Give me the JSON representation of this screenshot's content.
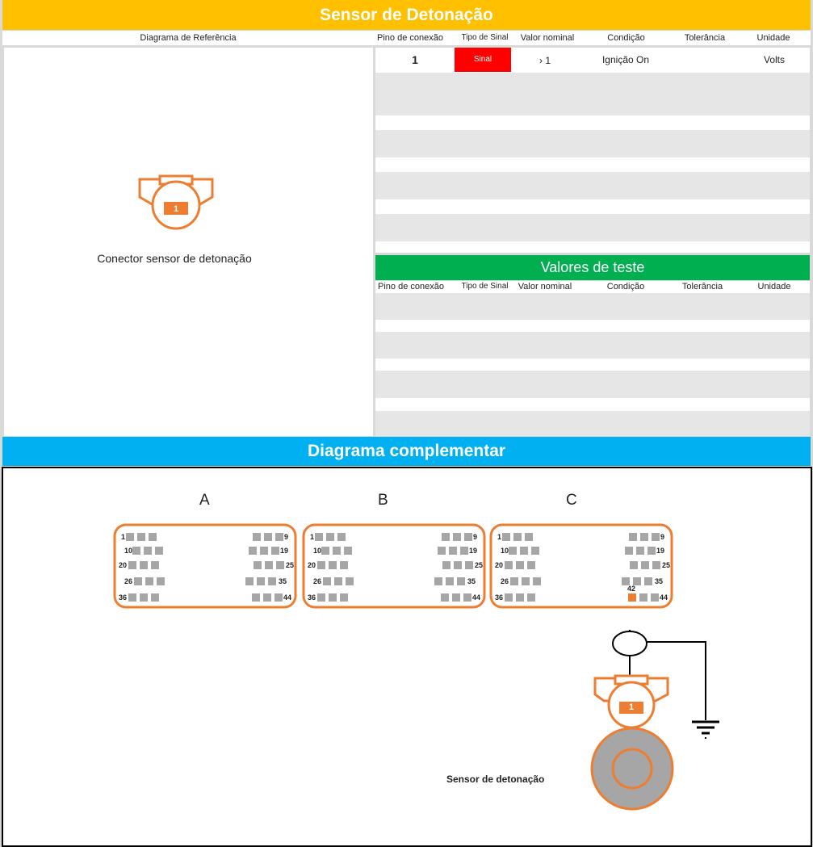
{
  "header": {
    "title": "Sensor de Detonação"
  },
  "columns": {
    "reference_diagram": "Diagrama de Referência",
    "pin": "Pino de conexão",
    "signal_type": "Tipo de Sinal",
    "nominal": "Valor nominal",
    "condition": "Condição",
    "tolerance": "Tolerância",
    "unit": "Unidade"
  },
  "main_table": {
    "rows": [
      {
        "pin": "1",
        "signal_type": "Sinal",
        "nominal": "› 1",
        "condition": "Ignição On",
        "tolerance": "",
        "unit": "Volts"
      }
    ]
  },
  "reference": {
    "pin_label": "1",
    "caption": "Conector sensor de detonação"
  },
  "test_values": {
    "title": "Valores de teste"
  },
  "complementary": {
    "title": "Diagrama complementar",
    "connectors": [
      {
        "letter": "A",
        "pins": [
          "1",
          "9",
          "10",
          "19",
          "20",
          "25",
          "26",
          "35",
          "36",
          "44"
        ]
      },
      {
        "letter": "B",
        "pins": [
          "1",
          "9",
          "10",
          "19",
          "20",
          "25",
          "26",
          "35",
          "36",
          "44"
        ]
      },
      {
        "letter": "C",
        "pins": [
          "1",
          "9",
          "10",
          "19",
          "20",
          "25",
          "26",
          "35",
          "36",
          "44"
        ]
      }
    ],
    "highlight_pin": "42",
    "sensor_pin_label": "1",
    "sensor_caption": "Sensor de detonação"
  },
  "colors": {
    "orange": "#ed7d31",
    "yellow": "#ffc000",
    "green": "#00b050",
    "blue": "#00b0f0",
    "red": "#ff0000",
    "grey": "#a6a6a6"
  }
}
